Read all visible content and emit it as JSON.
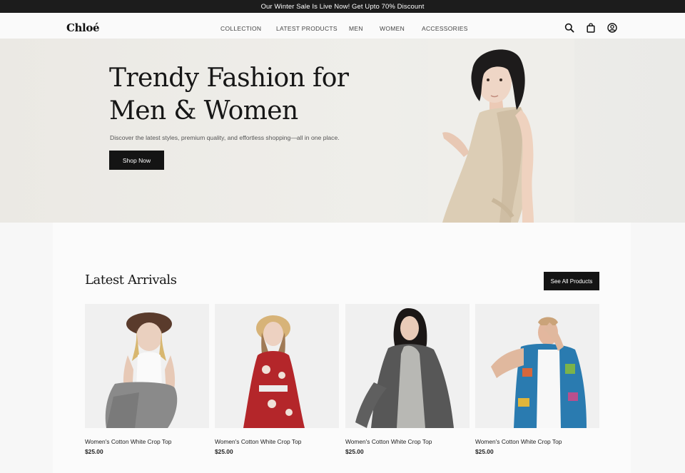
{
  "announcement": "Our Winter Sale Is Live Now! Get Upto 70% Discount",
  "header": {
    "logo": "Chloé",
    "nav": [
      "COLLECTION",
      "LATEST PRODUCTS",
      "MEN",
      "WOMEN",
      "ACCESSORIES"
    ],
    "icons": [
      "search-icon",
      "shopping-bag-icon",
      "account-icon"
    ]
  },
  "hero": {
    "title_line1": "Trendy Fashion for",
    "title_line2": "Men & Women",
    "subtitle": "Discover the latest styles, premium quality, and effortless shopping—all in one place.",
    "cta": "Shop Now"
  },
  "latest": {
    "title": "Latest Arrivals",
    "see_all": "See All Products",
    "products": [
      {
        "name": "Women's Cotton White Crop Top",
        "price": "$25.00"
      },
      {
        "name": "Women's Cotton White Crop Top",
        "price": "$25.00"
      },
      {
        "name": "Women's Cotton White Crop Top",
        "price": "$25.00"
      },
      {
        "name": "Women's Cotton White Crop Top",
        "price": "$25.00"
      }
    ]
  },
  "colors": {
    "accent_dark": "#141414",
    "hero_bg": "#ecebe7",
    "card_bg": "#f0f0f0"
  }
}
